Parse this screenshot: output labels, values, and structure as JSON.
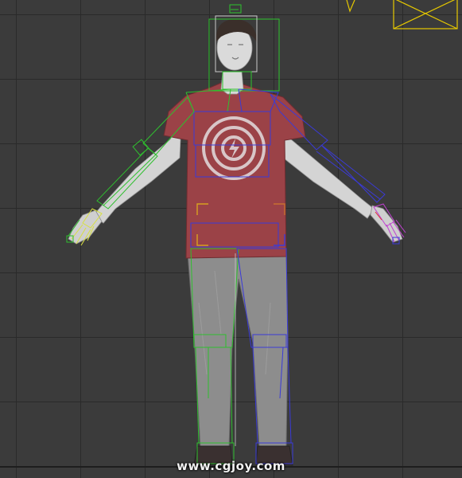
{
  "viewport": {
    "watermark": "www.cgjoy.com",
    "colors": {
      "background": "#3b3b3b",
      "grid": "#2a2a2a",
      "skin": "#dcdcdc",
      "shirt": "#9c4448",
      "pants": "#8e8e8e",
      "bone_left": "#2fbf2f",
      "bone_right": "#3a3ad8",
      "bone_head": "#28c828",
      "hand_left": "#d8e040",
      "hand_right": "#c040d0",
      "camera_gizmo": "#e6c800"
    },
    "objects": {
      "character": "character-model",
      "biped": "biped-rig",
      "gizmo": "camera-gizmo"
    }
  }
}
